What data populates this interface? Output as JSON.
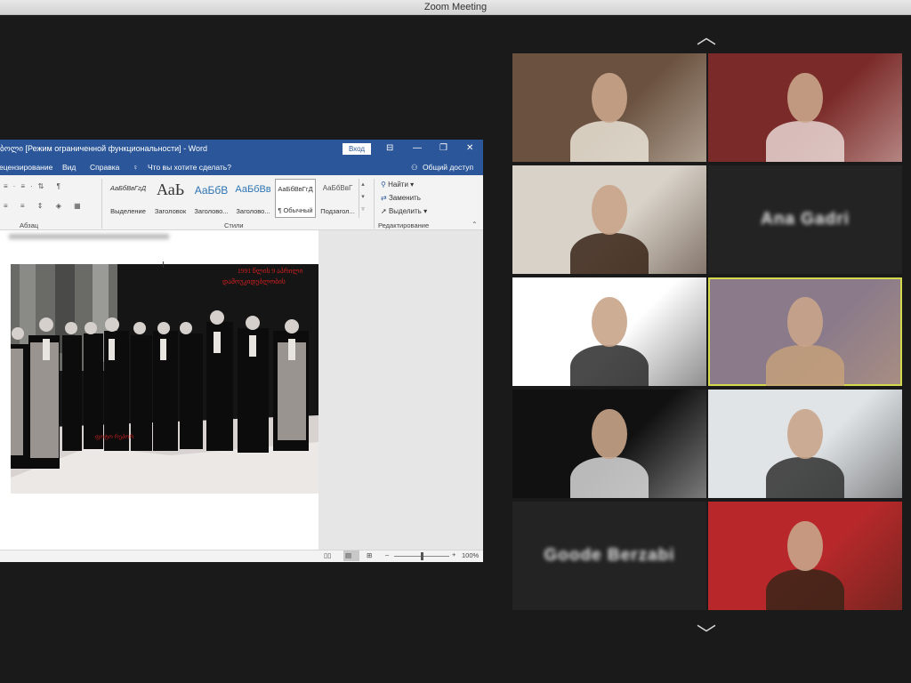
{
  "window": {
    "title": "Zoom Meeting"
  },
  "word": {
    "title": "ბოლი [Режим ограниченной функциональности]  -  Word",
    "signin_label": "Вход",
    "menu": [
      "ецензирование",
      "Вид",
      "Справка"
    ],
    "search_prompt": "Что вы хотите сделать?",
    "share_label": "Общий доступ",
    "groups": {
      "paragraph": "Абзац",
      "styles": "Стили",
      "editing": "Редактирование"
    },
    "styles": [
      {
        "sample": "АаБбВвГгД",
        "name": "Выделение"
      },
      {
        "sample": "АаЬ",
        "name": "Заголовок"
      },
      {
        "sample": "АаБбВ",
        "name": "Заголово..."
      },
      {
        "sample": "АаБбВв",
        "name": "Заголово..."
      },
      {
        "sample": "АаБбВвГгД",
        "name": "¶ Обычный"
      },
      {
        "sample": "АаБбВвГ",
        "name": "Подзагол..."
      }
    ],
    "editing": {
      "find": "Найти",
      "replace": "Заменить",
      "select": "Выделить"
    },
    "photo_caption_top": "1991 წლის 9 აპრილი\nდამოუკიდებლობის",
    "zoom_level": "100%",
    "zoom_fraction": 0.5
  },
  "participants": [
    {
      "name": "",
      "type": "video",
      "palette": [
        "#6b5240",
        "#e9e3d6"
      ]
    },
    {
      "name": "",
      "type": "video",
      "palette": [
        "#7a2a28",
        "#e8d6d2"
      ]
    },
    {
      "name": "",
      "type": "video",
      "palette": [
        "#d8d2c8",
        "#3a2418"
      ]
    },
    {
      "name": "Ana Gadri",
      "type": "name"
    },
    {
      "name": "",
      "type": "video",
      "palette": [
        "#ffffff",
        "#2a2a2a"
      ]
    },
    {
      "name": "",
      "type": "video",
      "palette": [
        "#8a7a8a",
        "#c4a07a"
      ],
      "active": true
    },
    {
      "name": "",
      "type": "video",
      "palette": [
        "#111111",
        "#d8d8d8"
      ]
    },
    {
      "name": "",
      "type": "video",
      "palette": [
        "#e0e4e6",
        "#303030"
      ]
    },
    {
      "name": "Goode Berzabi",
      "type": "name"
    },
    {
      "name": "",
      "type": "video",
      "palette": [
        "#b8282a",
        "#3a2418"
      ]
    }
  ],
  "colors": {
    "accent": "#2b579a",
    "active_speaker": "#d4d84b",
    "tile_dark": "#232323"
  },
  "icons": [
    "chevron-up-icon",
    "chevron-down-icon"
  ]
}
